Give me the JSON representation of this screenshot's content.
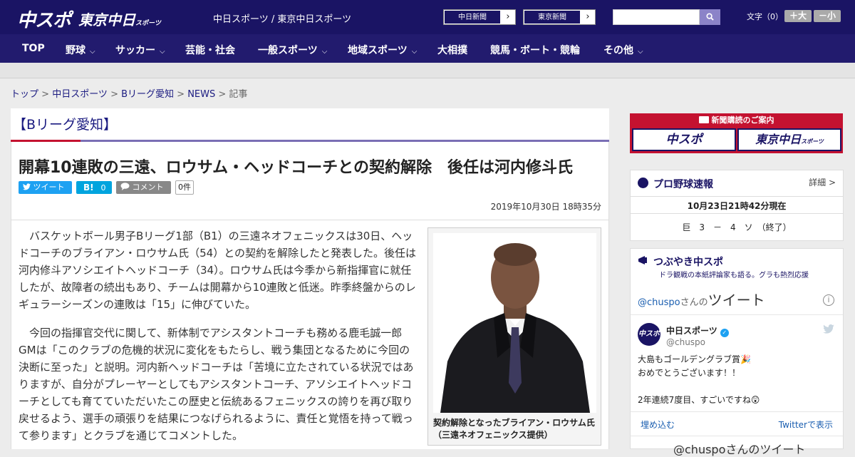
{
  "header": {
    "logo_main": "中スポ",
    "logo_tokyo": "東京中日",
    "logo_tokyo_small": "スポーツ",
    "site_name": "中日スポーツ / 東京中日スポーツ",
    "paper_links": [
      {
        "label": "中日新聞",
        "arrow": "›"
      },
      {
        "label": "東京新聞",
        "arrow": "›"
      }
    ],
    "search_placeholder": "",
    "font_size_label": "文字（0）",
    "font_bigger": "＋大",
    "font_smaller": "－小"
  },
  "nav": {
    "items": [
      {
        "label": "TOP",
        "chev": ""
      },
      {
        "label": "野球",
        "chev": "⌵"
      },
      {
        "label": "サッカー",
        "chev": "⌵"
      },
      {
        "label": "芸能・社会",
        "chev": ""
      },
      {
        "label": "一般スポーツ",
        "chev": "⌵"
      },
      {
        "label": "地域スポーツ",
        "chev": "⌵"
      },
      {
        "label": "大相撲",
        "chev": ""
      },
      {
        "label": "競馬・ボート・競輪",
        "chev": ""
      },
      {
        "label": "その他",
        "chev": "⌵"
      }
    ]
  },
  "breadcrumb": {
    "items": [
      "トップ",
      "中日スポーツ",
      "Bリーグ愛知",
      "NEWS"
    ],
    "current": "記事",
    "sep": " > "
  },
  "category": {
    "title": "【Bリーグ愛知】"
  },
  "article": {
    "headline": "開幕10連敗の三遠、ロウサム・ヘッドコーチとの契約解除　後任は河内修斗氏",
    "share": {
      "tweet": "ツイート",
      "hatena": "B!",
      "hatena_count": "0",
      "comment": "コメント",
      "comment_count": "0件"
    },
    "date": "2019年10月30日 18時35分",
    "paragraphs": [
      "バスケットボール男子Bリーグ1部（B1）の三遠ネオフェニックスは30日、ヘッドコーチのブライアン・ロウサム氏（54）との契約を解除したと発表した。後任は河内修斗アソシエイトヘッドコーチ（34）。ロウサム氏は今季から新指揮官に就任したが、故障者の続出もあり、チームは開幕から10連敗と低迷。昨季終盤からのレギュラーシーズンの連敗は「15」に伸びていた。",
      "今回の指揮官交代に関して、新体制でアシスタントコーチも務める鹿毛誠一郎GMは「このクラブの危機的状況に変化をもたらし、戦う集団となるために今回の決断に至った」と説明。河内新ヘッドコーチは「苦境に立たされている状況ではありますが、自分がプレーヤーとしてもアシスタントコーチ、アソシエイトヘッドコーチとしても育てていただいたこの歴史と伝統あるフェニックスの誇りを再び取り戻せるよう、選手の頑張りを結果につなげられるように、責任と覚悟を持って戦って参ります」とクラブを通じてコメントした。"
    ],
    "photo_caption": "契約解除となったブライアン・ロウサム氏（三遠ネオフェニックス提供）"
  },
  "sidebar": {
    "ad": {
      "title": "新聞購読のご案内",
      "left": "中スポ",
      "right": "東京中日",
      "right_small": "スポーツ"
    },
    "baseball": {
      "title": "プロ野球速報",
      "detail": "詳細 >",
      "time": "10月23日21時42分現在",
      "score": "巨　3　－　4　ソ　（終了）"
    },
    "tweets": {
      "title": "つぶやき中スポ",
      "subtitle": "ドラ観戦の本紙評論家も語る。グラも熱烈応援",
      "handle_link": "@chuspo",
      "handle_suffix": "さんの",
      "tweets_label": "ツイート",
      "account_name": "中日スポーツ",
      "account_handle": "@chuspo",
      "avatar_text": "中スポ",
      "tweet_lines": [
        "大島もゴールデングラブ賞🎉",
        "おめでとうございます！！",
        "",
        "2年連続7度目、すごいですね😲"
      ],
      "embed": "埋め込む",
      "view_on": "Twitterで表示",
      "footer_title": "@chuspoさんのツイート"
    }
  },
  "colors": {
    "brand_navy": "#1a1464",
    "accent_red": "#c41230",
    "accent_purple": "#7a6fb4",
    "twitter_blue": "#1da1f2",
    "hatena_blue": "#00a4de"
  }
}
